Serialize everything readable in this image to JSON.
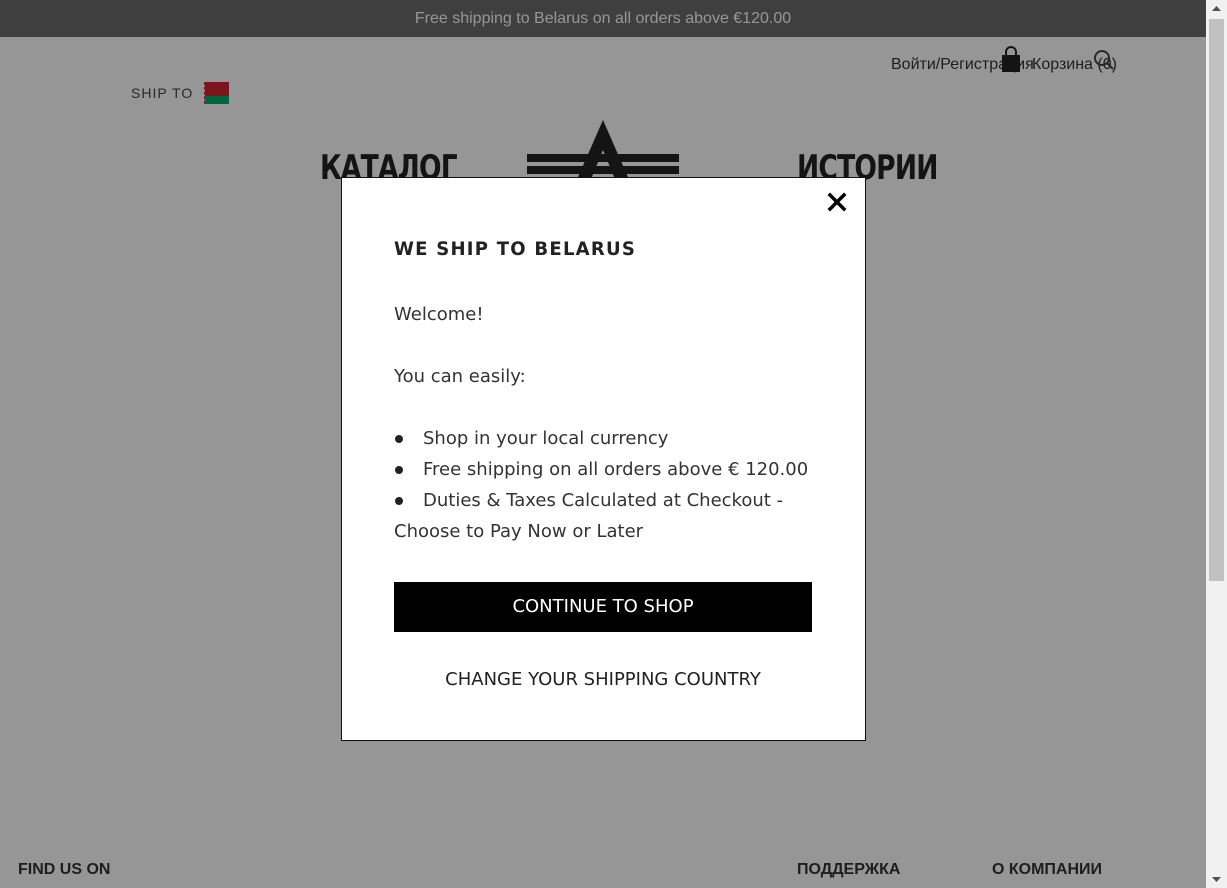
{
  "promo": {
    "text": "Free shipping to Belarus on all orders above €120.00"
  },
  "header": {
    "login_label": "Войти/Регистрация",
    "cart_label": "Корзина (0)",
    "ship_to_label": "SHIP TO",
    "ship_to_country_flag": "belarus-flag"
  },
  "nav": {
    "catalog": "КАТАЛОГ",
    "stories": "ИСТОРИИ"
  },
  "footer": {
    "find_us": "FIND US ON",
    "support": "ПОДДЕРЖКА",
    "about": "О КОМПАНИИ"
  },
  "modal": {
    "title": "WE SHIP TO BELARUS",
    "welcome": "Welcome!",
    "intro": "You can easily:",
    "bullets": [
      "Shop in your local currency",
      "Free shipping on all orders above € 120.00",
      "Duties & Taxes Calculated at Checkout - Choose to Pay Now or Later"
    ],
    "continue_label": "CONTINUE TO SHOP",
    "change_label": "CHANGE YOUR SHIPPING COUNTRY"
  },
  "colors": {
    "overlay": "#000000",
    "promo_bg": "#6b6b6b",
    "button_bg": "#000000",
    "flag_red": "#d22730",
    "flag_green": "#00af66"
  }
}
